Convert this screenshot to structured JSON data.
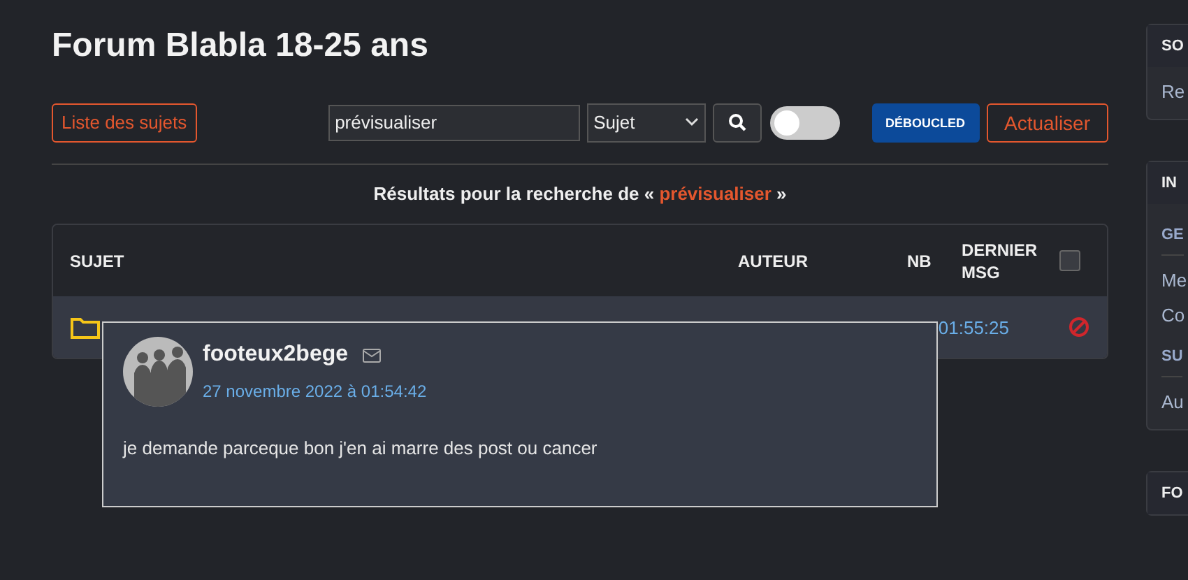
{
  "title": "Forum Blabla 18-25 ans",
  "toolbar": {
    "topics_button": "Liste des sujets",
    "search": {
      "value": "prévisualiser"
    },
    "search_type": "Sujet",
    "toggle": {
      "on": false
    },
    "debloque_button": "DÉBOUCLED",
    "refresh_button": "Actualiser"
  },
  "results": {
    "prefix": "Résultats pour la recherche de « ",
    "term": "prévisualiser",
    "suffix": " »"
  },
  "table": {
    "columns": [
      "SUJET",
      "AUTEUR",
      "NB",
      "DERNIER MSG"
    ],
    "select_all": {
      "checked": false
    },
    "rows": [
      {
        "last_msg": "01:55:25"
      }
    ]
  },
  "preview": {
    "author": "footeux2bege",
    "date": "27 novembre 2022 à 01:54:42",
    "text": "je demande parceque bon j'en ai marre des post ou cancer"
  },
  "sidebar": {
    "panels": [
      {
        "title": "SO",
        "items": [
          {
            "kind": "link",
            "text": "Re"
          }
        ]
      },
      {
        "title": "IN",
        "items": [
          {
            "kind": "heading",
            "text": "GE"
          },
          {
            "kind": "link",
            "text": "Me"
          },
          {
            "kind": "link",
            "text": "Co"
          },
          {
            "kind": "heading",
            "text": "SU"
          },
          {
            "kind": "link",
            "text": "Au"
          }
        ]
      },
      {
        "title": "FO"
      }
    ]
  }
}
